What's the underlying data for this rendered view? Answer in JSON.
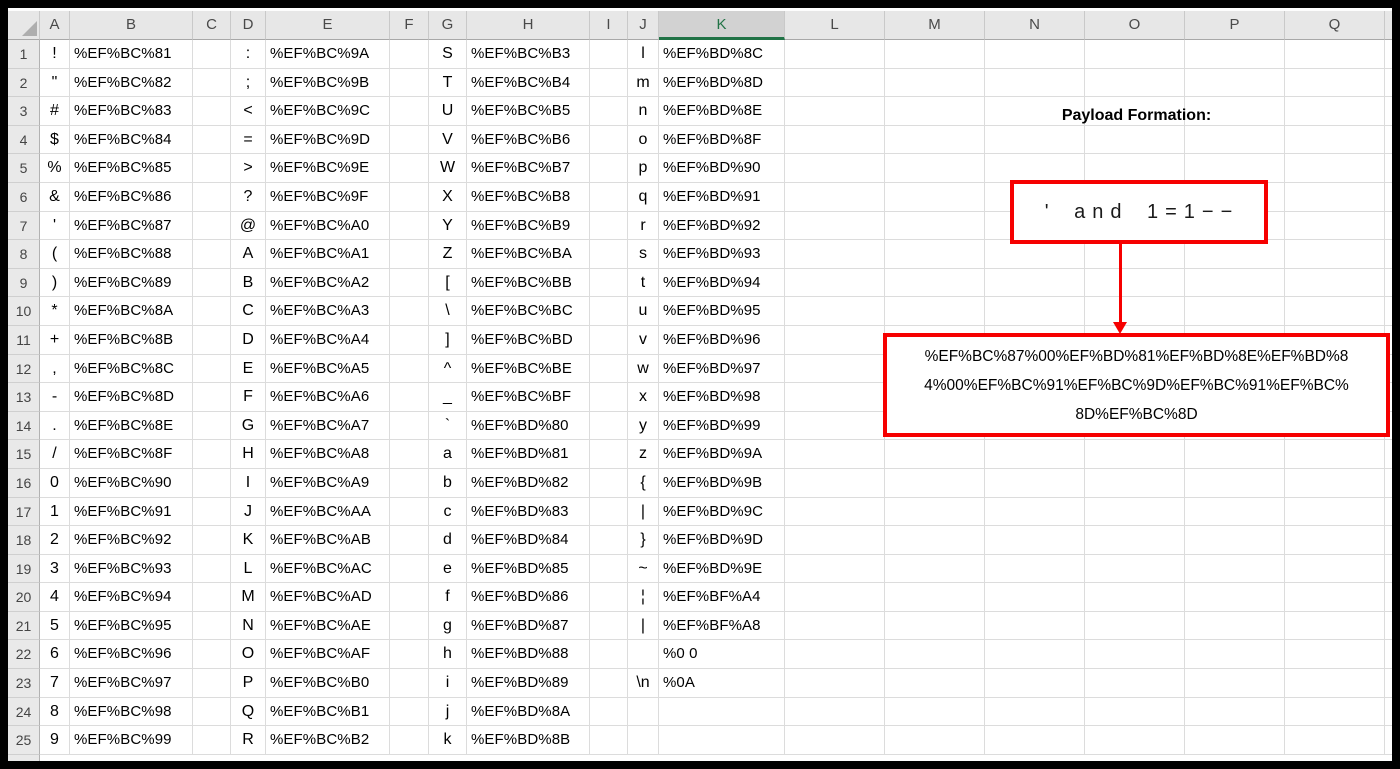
{
  "columns": [
    "A",
    "B",
    "C",
    "D",
    "E",
    "F",
    "G",
    "H",
    "I",
    "J",
    "K",
    "L",
    "M",
    "N",
    "O",
    "P",
    "Q"
  ],
  "selected_column": "K",
  "row_numbers": [
    1,
    2,
    3,
    4,
    5,
    6,
    7,
    8,
    9,
    10,
    11,
    12,
    13,
    14,
    15,
    16,
    17,
    18,
    19,
    20,
    21,
    22,
    23,
    24,
    25
  ],
  "grid": {
    "pairs": [
      {
        "char_column": "A",
        "code_column": "B",
        "entries": [
          [
            "!",
            "%EF%BC%81"
          ],
          [
            "\"",
            "%EF%BC%82"
          ],
          [
            "#",
            "%EF%BC%83"
          ],
          [
            "$",
            "%EF%BC%84"
          ],
          [
            "%",
            "%EF%BC%85"
          ],
          [
            "&",
            "%EF%BC%86"
          ],
          [
            "'",
            "%EF%BC%87"
          ],
          [
            "(",
            "%EF%BC%88"
          ],
          [
            ")",
            "%EF%BC%89"
          ],
          [
            "*",
            "%EF%BC%8A"
          ],
          [
            "+",
            "%EF%BC%8B"
          ],
          [
            ",",
            "%EF%BC%8C"
          ],
          [
            "-",
            "%EF%BC%8D"
          ],
          [
            ".",
            "%EF%BC%8E"
          ],
          [
            "/",
            "%EF%BC%8F"
          ],
          [
            "0",
            "%EF%BC%90"
          ],
          [
            "1",
            "%EF%BC%91"
          ],
          [
            "2",
            "%EF%BC%92"
          ],
          [
            "3",
            "%EF%BC%93"
          ],
          [
            "4",
            "%EF%BC%94"
          ],
          [
            "5",
            "%EF%BC%95"
          ],
          [
            "6",
            "%EF%BC%96"
          ],
          [
            "7",
            "%EF%BC%97"
          ],
          [
            "8",
            "%EF%BC%98"
          ],
          [
            "9",
            "%EF%BC%99"
          ]
        ]
      },
      {
        "char_column": "D",
        "code_column": "E",
        "entries": [
          [
            ":",
            "%EF%BC%9A"
          ],
          [
            ";",
            "%EF%BC%9B"
          ],
          [
            "<",
            "%EF%BC%9C"
          ],
          [
            "=",
            "%EF%BC%9D"
          ],
          [
            ">",
            "%EF%BC%9E"
          ],
          [
            "?",
            "%EF%BC%9F"
          ],
          [
            "@",
            "%EF%BC%A0"
          ],
          [
            "A",
            "%EF%BC%A1"
          ],
          [
            "B",
            "%EF%BC%A2"
          ],
          [
            "C",
            "%EF%BC%A3"
          ],
          [
            "D",
            "%EF%BC%A4"
          ],
          [
            "E",
            "%EF%BC%A5"
          ],
          [
            "F",
            "%EF%BC%A6"
          ],
          [
            "G",
            "%EF%BC%A7"
          ],
          [
            "H",
            "%EF%BC%A8"
          ],
          [
            "I",
            "%EF%BC%A9"
          ],
          [
            "J",
            "%EF%BC%AA"
          ],
          [
            "K",
            "%EF%BC%AB"
          ],
          [
            "L",
            "%EF%BC%AC"
          ],
          [
            "M",
            "%EF%BC%AD"
          ],
          [
            "N",
            "%EF%BC%AE"
          ],
          [
            "O",
            "%EF%BC%AF"
          ],
          [
            "P",
            "%EF%BC%B0"
          ],
          [
            "Q",
            "%EF%BC%B1"
          ],
          [
            "R",
            "%EF%BC%B2"
          ]
        ]
      },
      {
        "char_column": "G",
        "code_column": "H",
        "entries": [
          [
            "S",
            "%EF%BC%B3"
          ],
          [
            "T",
            "%EF%BC%B4"
          ],
          [
            "U",
            "%EF%BC%B5"
          ],
          [
            "V",
            "%EF%BC%B6"
          ],
          [
            "W",
            "%EF%BC%B7"
          ],
          [
            "X",
            "%EF%BC%B8"
          ],
          [
            "Y",
            "%EF%BC%B9"
          ],
          [
            "Z",
            "%EF%BC%BA"
          ],
          [
            "[",
            "%EF%BC%BB"
          ],
          [
            "\\",
            "%EF%BC%BC"
          ],
          [
            "]",
            "%EF%BC%BD"
          ],
          [
            "^",
            "%EF%BC%BE"
          ],
          [
            "_",
            "%EF%BC%BF"
          ],
          [
            "`",
            "%EF%BD%80"
          ],
          [
            "a",
            "%EF%BD%81"
          ],
          [
            "b",
            "%EF%BD%82"
          ],
          [
            "c",
            "%EF%BD%83"
          ],
          [
            "d",
            "%EF%BD%84"
          ],
          [
            "e",
            "%EF%BD%85"
          ],
          [
            "f",
            "%EF%BD%86"
          ],
          [
            "g",
            "%EF%BD%87"
          ],
          [
            "h",
            "%EF%BD%88"
          ],
          [
            "i",
            "%EF%BD%89"
          ],
          [
            "j",
            "%EF%BD%8A"
          ],
          [
            "k",
            "%EF%BD%8B"
          ]
        ]
      },
      {
        "char_column": "J",
        "code_column": "K",
        "entries": [
          [
            "l",
            "%EF%BD%8C"
          ],
          [
            "m",
            "%EF%BD%8D"
          ],
          [
            "n",
            "%EF%BD%8E"
          ],
          [
            "o",
            "%EF%BD%8F"
          ],
          [
            "p",
            "%EF%BD%90"
          ],
          [
            "q",
            "%EF%BD%91"
          ],
          [
            "r",
            "%EF%BD%92"
          ],
          [
            "s",
            "%EF%BD%93"
          ],
          [
            "t",
            "%EF%BD%94"
          ],
          [
            "u",
            "%EF%BD%95"
          ],
          [
            "v",
            "%EF%BD%96"
          ],
          [
            "w",
            "%EF%BD%97"
          ],
          [
            "x",
            "%EF%BD%98"
          ],
          [
            "y",
            "%EF%BD%99"
          ],
          [
            "z",
            "%EF%BD%9A"
          ],
          [
            "{",
            "%EF%BD%9B"
          ],
          [
            "|",
            "%EF%BD%9C"
          ],
          [
            "}",
            "%EF%BD%9D"
          ],
          [
            "~",
            "%EF%BD%9E"
          ],
          [
            "¦",
            "%EF%BF%A4"
          ],
          [
            "|",
            "%EF%BF%A8"
          ],
          [
            "",
            "%0 0"
          ],
          [
            "\\n",
            "%0A"
          ],
          [
            "",
            ""
          ],
          [
            "",
            ""
          ]
        ]
      }
    ]
  },
  "payload": {
    "title": "Payload Formation:",
    "input_text": "' and 1=1−−",
    "encoded_lines": [
      "%EF%BC%87%00%EF%BD%81%EF%BD%8E%EF%BD%8",
      "4%00%EF%BC%91%EF%BC%9D%EF%BC%91%EF%BC%",
      "8D%EF%BC%8D"
    ]
  },
  "colors": {
    "accent_red": "#F60000",
    "excel_green": "#217346",
    "header_bg": "#E7E7E7",
    "header_selected_bg": "#D2D2D2",
    "gridline": "#DCDCDC"
  }
}
